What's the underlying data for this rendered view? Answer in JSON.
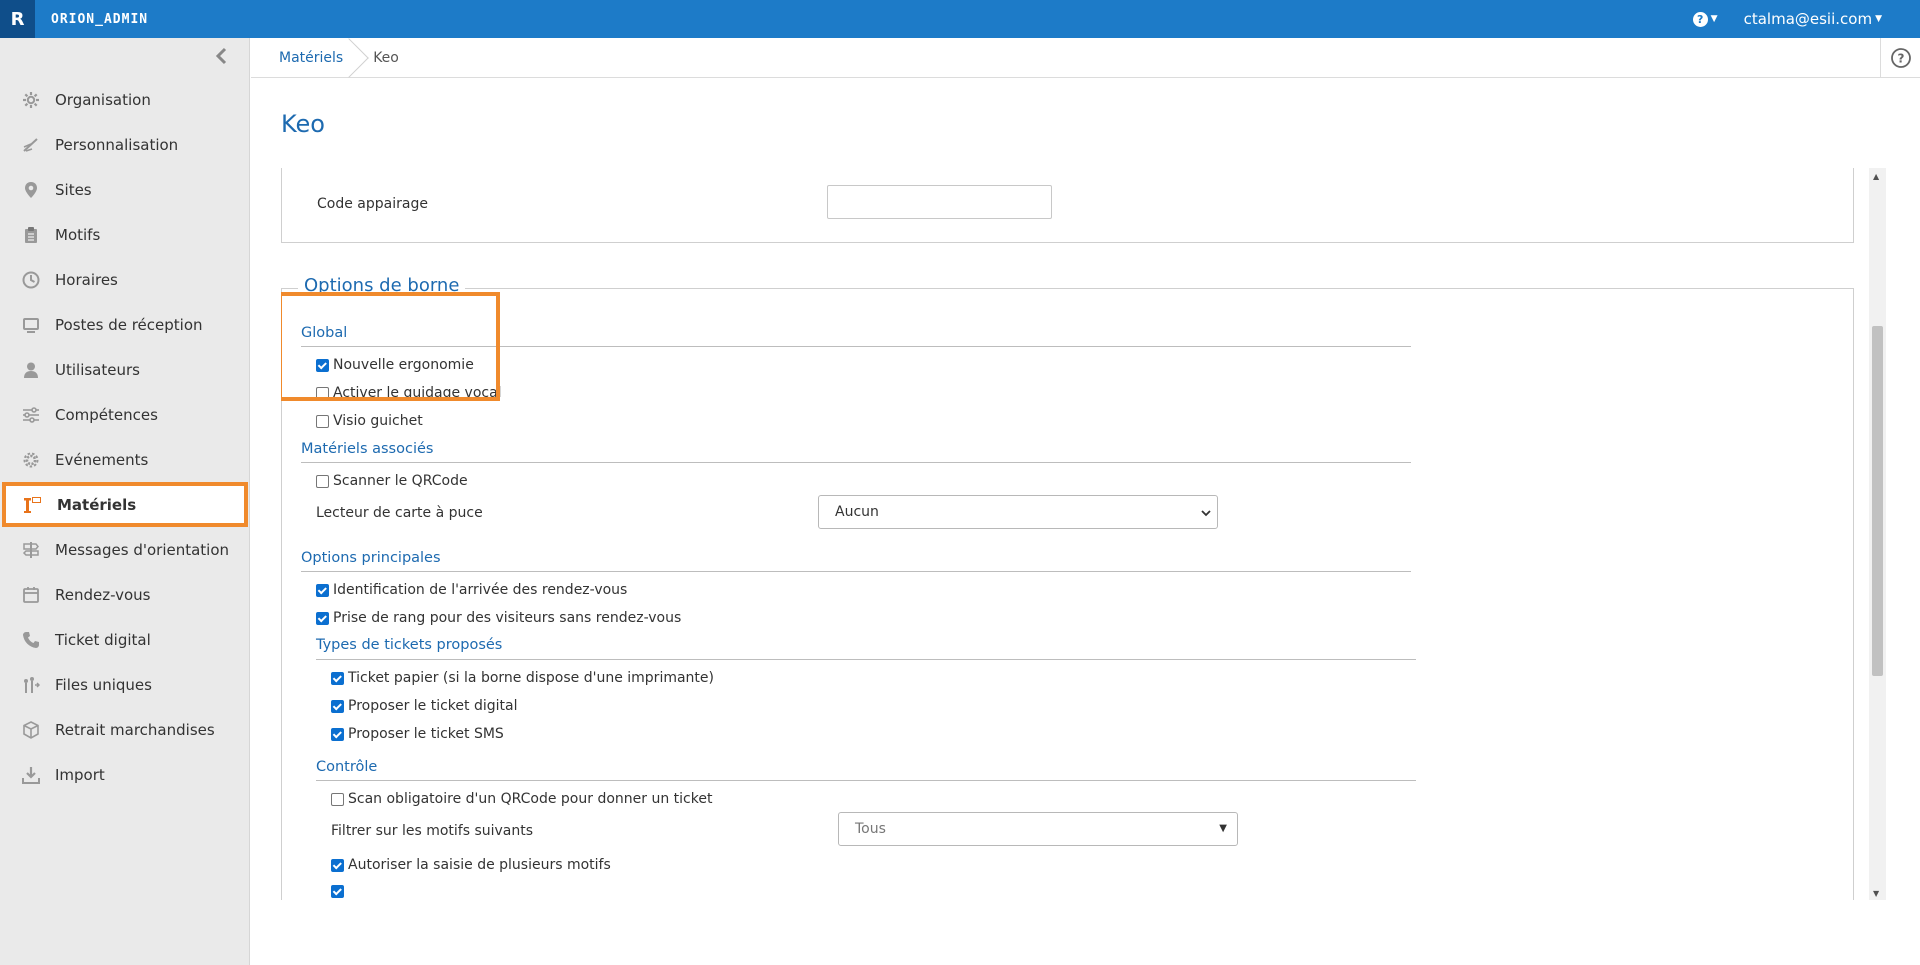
{
  "app": {
    "logo": "R",
    "title": "ORION_ADMIN",
    "help_icon": "question-circle-icon",
    "user": "ctalma@esii.com"
  },
  "sidebar": {
    "items": [
      {
        "label": "Organisation",
        "icon": "gear-icon"
      },
      {
        "label": "Personnalisation",
        "icon": "brush-icon"
      },
      {
        "label": "Sites",
        "icon": "map-pin-icon"
      },
      {
        "label": "Motifs",
        "icon": "clipboard-icon"
      },
      {
        "label": "Horaires",
        "icon": "clock-icon"
      },
      {
        "label": "Postes de réception",
        "icon": "monitor-icon"
      },
      {
        "label": "Utilisateurs",
        "icon": "user-icon"
      },
      {
        "label": "Compétences",
        "icon": "sliders-icon"
      },
      {
        "label": "Evénements",
        "icon": "cog-icon"
      },
      {
        "label": "Matériels",
        "icon": "kiosk-icon",
        "active": true
      },
      {
        "label": "Messages d'orientation",
        "icon": "signpost-icon"
      },
      {
        "label": "Rendez-vous",
        "icon": "calendar-icon"
      },
      {
        "label": "Ticket digital",
        "icon": "phone-icon"
      },
      {
        "label": "Files uniques",
        "icon": "queue-icon"
      },
      {
        "label": "Retrait marchandises",
        "icon": "box-icon"
      },
      {
        "label": "Import",
        "icon": "download-icon"
      }
    ]
  },
  "breadcrumb": {
    "parent": "Matériels",
    "current": "Keo"
  },
  "page": {
    "title": "Keo"
  },
  "appairage": {
    "code_label": "Code appairage",
    "code_value": ""
  },
  "options": {
    "legend": "Options de borne",
    "global": {
      "title": "Global",
      "nouvelle_ergonomie": "Nouvelle ergonomie",
      "guidage_vocal": "Activer le guidage vocal",
      "visio_guichet": "Visio guichet"
    },
    "materiels": {
      "title": "Matériels associés",
      "scanner_qr": "Scanner le QRCode",
      "lecteur_label": "Lecteur de carte à puce",
      "lecteur_value": "Aucun"
    },
    "principales": {
      "title": "Options principales",
      "identification": "Identification de l'arrivée des rendez-vous",
      "prise_rang": "Prise de rang pour des visiteurs sans rendez-vous",
      "types_title": "Types de tickets proposés",
      "ticket_papier": "Ticket papier (si la borne dispose d'une imprimante)",
      "ticket_digital": "Proposer le ticket digital",
      "ticket_sms": "Proposer le ticket SMS"
    },
    "controle": {
      "title": "Contrôle",
      "scan_obligatoire": "Scan obligatoire d'un QRCode pour donner un ticket",
      "filtrer_label": "Filtrer sur les motifs suivants",
      "filtrer_value": "Tous",
      "autoriser_plusieurs": "Autoriser la saisie de plusieurs motifs"
    }
  }
}
